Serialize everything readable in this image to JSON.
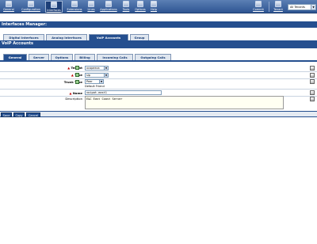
{
  "toolbar": {
    "items": [
      {
        "label": "General",
        "icon": "general-icon"
      },
      {
        "label": "Configuration",
        "icon": "configuration-icon"
      },
      {
        "label": "Interfaces",
        "icon": "interfaces-icon"
      },
      {
        "label": "Extensions",
        "icon": "extensions-icon"
      },
      {
        "label": "Lines",
        "icon": "lines-icon"
      },
      {
        "label": "Applications",
        "icon": "applications-icon"
      },
      {
        "label": "Tools",
        "icon": "tools-icon"
      },
      {
        "label": "Options",
        "icon": "options-icon"
      },
      {
        "label": "Help",
        "icon": "help-icon"
      }
    ],
    "right_items": [
      {
        "label": "Commit",
        "icon": "commit-icon"
      },
      {
        "label": "Tenant",
        "icon": "tenant-icon"
      }
    ],
    "tenant_select": "All Tenants",
    "active_item": "Interfaces"
  },
  "manager": {
    "title": "Interfaces Manager:"
  },
  "primary_tabs": [
    "Digital Interfaces",
    "Analog Interfaces",
    "VoIP Accounts",
    "Group"
  ],
  "primary_active": "VoIP Accounts",
  "section": {
    "title": "VoIP Accounts"
  },
  "secondary_tabs": [
    "General",
    "Server",
    "Options",
    "Billing",
    "Incoming Calls",
    "Outgoing Calls"
  ],
  "secondary_active": "General",
  "form": {
    "tenant": {
      "label": "Tenant",
      "value": "xcopeevx"
    },
    "type": {
      "label": "Type",
      "value": "sip"
    },
    "trunk_type": {
      "label": "Trunk Type",
      "value": "Peer",
      "note": "Default Friend"
    },
    "name": {
      "label": "Name",
      "value": "voipat-east1"
    },
    "description": {
      "label": "Description",
      "value": "E&C East Coast Server"
    }
  },
  "buttons": {
    "save": "Save",
    "copy": "Copy",
    "cancel": "Cancel"
  },
  "colors": {
    "toolbar": "#2e5592",
    "header": "#254f8f",
    "required": "#c00000",
    "textarea_bg": "#fffff2"
  }
}
